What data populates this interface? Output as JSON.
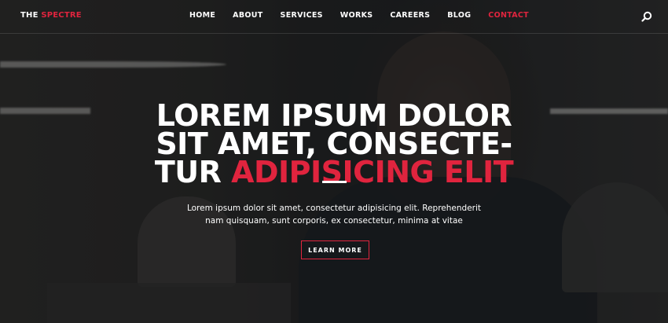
{
  "brand": {
    "prefix": "THE",
    "name": "SPECTRE"
  },
  "nav": {
    "items": [
      {
        "label": "HOME"
      },
      {
        "label": "ABOUT"
      },
      {
        "label": "SERVICES"
      },
      {
        "label": "WORKS"
      },
      {
        "label": "CAREERS"
      },
      {
        "label": "BLOG"
      },
      {
        "label": "CONTACT"
      }
    ],
    "active": "CONTACT",
    "search_icon": "search-icon"
  },
  "hero": {
    "title_line1": "LOREM IPSUM DOLOR",
    "title_line2": "SIT AMET, CONSECTE-",
    "title_line3_plain": "TUR ",
    "title_line3_accent": "ADIPISICING ELIT",
    "subtitle": "Lorem ipsum dolor sit amet, consectetur adipisicing elit. Reprehenderit nam quisquam, sunt corporis, ex consectetur, minima at vitae",
    "button_label": "LEARN MORE"
  },
  "colors": {
    "accent": "#e0243e",
    "text": "#ffffff",
    "background": "#1d1f22"
  }
}
